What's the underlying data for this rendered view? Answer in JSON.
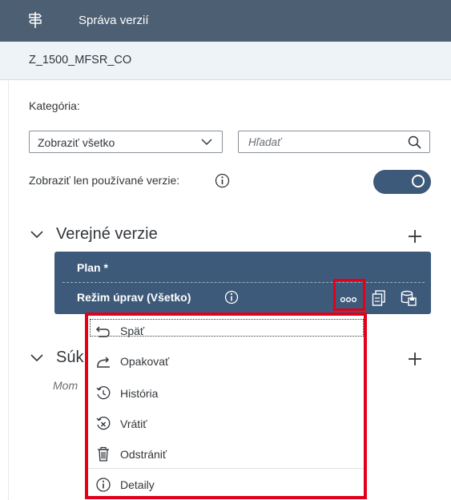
{
  "header": {
    "title": "Správa verzií",
    "icon": "signpost-icon"
  },
  "subheader": {
    "title": "Z_1500_MFSR_CO"
  },
  "filters": {
    "category_label": "Kategória:",
    "category_value": "Zobraziť všetko",
    "search_placeholder": "Hľadať",
    "show_used_label": "Zobraziť len používané verzie:",
    "show_used_on": true
  },
  "public_section": {
    "title": "Verejné verzie"
  },
  "version": {
    "name": "Plan *",
    "mode": "Režim úprav (Všetko)"
  },
  "shared_section": {
    "title": "Súk",
    "note": "Mom"
  },
  "menu": {
    "items": [
      {
        "label": "Späť",
        "icon": "undo-icon"
      },
      {
        "label": "Opakovať",
        "icon": "redo-icon"
      },
      {
        "label": "História",
        "icon": "history-icon"
      },
      {
        "label": "Vrátiť",
        "icon": "revert-icon"
      },
      {
        "label": "Odstrániť",
        "icon": "delete-icon"
      },
      {
        "label": "Detaily",
        "icon": "info-icon"
      }
    ]
  },
  "colors": {
    "header_bg": "#4d5f73",
    "accent": "#3e5a7a",
    "highlight": "#e2001a"
  }
}
